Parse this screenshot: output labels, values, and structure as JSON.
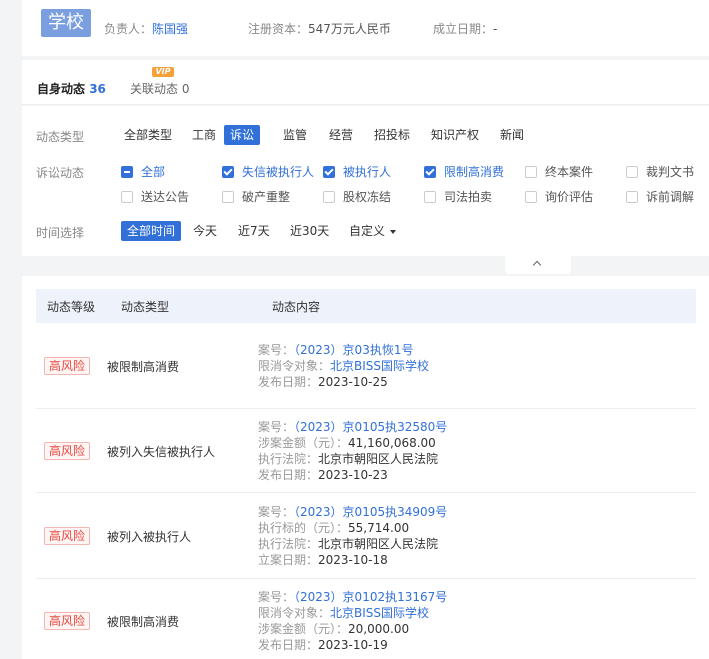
{
  "header": {
    "logo_text": "学校",
    "principal_label": "负责人：",
    "principal_name": "陈国强",
    "capital_label": "注册资本：",
    "capital_value": "547万元人民币",
    "founded_label": "成立日期：",
    "founded_value": "-"
  },
  "tabs": {
    "self_label": "自身动态",
    "self_count": "36",
    "related_label": "关联动态",
    "related_count": "0",
    "vip_badge": "VIP"
  },
  "filters": {
    "type_label": "动态类型",
    "types": [
      "全部类型",
      "工商",
      "诉讼",
      "监管",
      "经营",
      "招投标",
      "知识产权",
      "新闻"
    ],
    "selected_type": "诉讼",
    "litigation_label": "诉讼动态",
    "litigation_options": [
      {
        "label": "全部",
        "state": "partial"
      },
      {
        "label": "失信被执行人",
        "state": "on"
      },
      {
        "label": "被执行人",
        "state": "on"
      },
      {
        "label": "限制高消费",
        "state": "on"
      },
      {
        "label": "终本案件",
        "state": "off"
      },
      {
        "label": "裁判文书",
        "state": "off"
      },
      {
        "label": "送达公告",
        "state": "off"
      },
      {
        "label": "破产重整",
        "state": "off"
      },
      {
        "label": "股权冻结",
        "state": "off"
      },
      {
        "label": "司法拍卖",
        "state": "off"
      },
      {
        "label": "询价评估",
        "state": "off"
      },
      {
        "label": "诉前调解",
        "state": "off"
      }
    ],
    "time_label": "时间选择",
    "times": [
      "全部时间",
      "今天",
      "近7天",
      "近30天",
      "自定义"
    ],
    "selected_time": "全部时间"
  },
  "table": {
    "headers": [
      "动态等级",
      "动态类型",
      "动态内容"
    ],
    "rows": [
      {
        "level": "高风险",
        "type": "被限制高消费",
        "lines": [
          {
            "label": "案号：",
            "value": "（2023）京03执恢1号",
            "style": "link"
          },
          {
            "label": "限消令对象：",
            "value": "北京BISS国际学校",
            "style": "link"
          },
          {
            "label": "发布日期：",
            "value": "2023-10-25",
            "style": "dark"
          }
        ]
      },
      {
        "level": "高风险",
        "type": "被列入失信被执行人",
        "lines": [
          {
            "label": "案号：",
            "value": "（2023）京0105执32580号",
            "style": "link"
          },
          {
            "label": "涉案金额（元）：",
            "value": "41,160,068.00",
            "style": "dark"
          },
          {
            "label": "执行法院：",
            "value": "北京市朝阳区人民法院",
            "style": "dark"
          },
          {
            "label": "发布日期：",
            "value": "2023-10-23",
            "style": "dark"
          }
        ]
      },
      {
        "level": "高风险",
        "type": "被列入被执行人",
        "lines": [
          {
            "label": "案号：",
            "value": "（2023）京0105执34909号",
            "style": "link"
          },
          {
            "label": "执行标的（元）：",
            "value": "55,714.00",
            "style": "dark"
          },
          {
            "label": "执行法院：",
            "value": "北京市朝阳区人民法院",
            "style": "dark"
          },
          {
            "label": "立案日期：",
            "value": "2023-10-18",
            "style": "dark"
          }
        ]
      },
      {
        "level": "高风险",
        "type": "被限制高消费",
        "lines": [
          {
            "label": "案号：",
            "value": "（2023）京0102执13167号",
            "style": "link"
          },
          {
            "label": "限消令对象：",
            "value": "北京BISS国际学校",
            "style": "link"
          },
          {
            "label": "涉案金额（元）：",
            "value": "20,000.00",
            "style": "dark"
          },
          {
            "label": "发布日期：",
            "value": "2023-10-19",
            "style": "dark"
          }
        ]
      }
    ]
  },
  "colors": {
    "accent": "#3170d8",
    "risk": "#e8453c",
    "vip": "#f5a13a"
  }
}
